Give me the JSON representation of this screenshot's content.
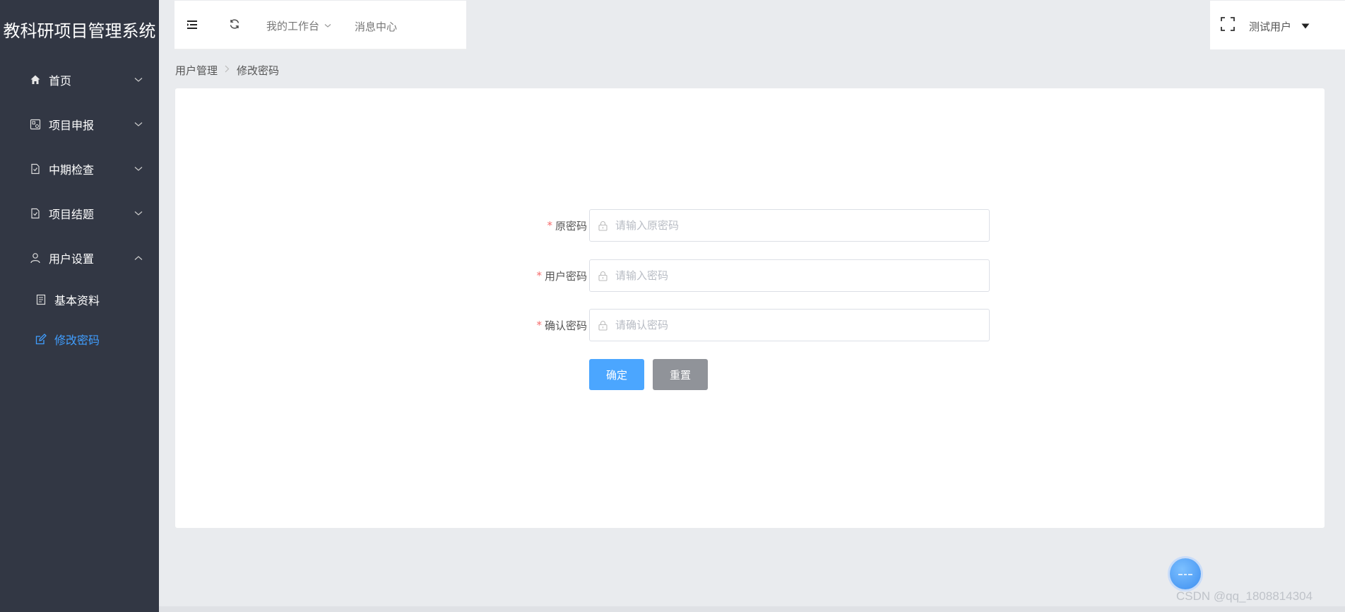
{
  "app": {
    "title": "教科研项目管理系统"
  },
  "sidebar": {
    "items": [
      {
        "label": "首页",
        "icon": "home-icon"
      },
      {
        "label": "项目申报",
        "icon": "project-apply-icon"
      },
      {
        "label": "中期检查",
        "icon": "doc-check-icon"
      },
      {
        "label": "项目结题",
        "icon": "doc-check-icon"
      },
      {
        "label": "用户设置",
        "icon": "user-icon"
      }
    ],
    "subitems": [
      {
        "label": "基本资料",
        "icon": "document-icon"
      },
      {
        "label": "修改密码",
        "icon": "edit-icon",
        "active": true
      }
    ]
  },
  "header": {
    "tabs": [
      {
        "label": "我的工作台"
      },
      {
        "label": "消息中心"
      }
    ],
    "user": "测试用户"
  },
  "breadcrumb": {
    "items": [
      "用户管理",
      "修改密码"
    ]
  },
  "form": {
    "fields": [
      {
        "label": "原密码",
        "placeholder": "请输入原密码",
        "required": "*"
      },
      {
        "label": "用户密码",
        "placeholder": "请输入密码",
        "required": "*"
      },
      {
        "label": "确认密码",
        "placeholder": "请确认密码",
        "required": "*"
      }
    ],
    "submit_label": "确定",
    "reset_label": "重置"
  },
  "watermark": "CSDN @qq_1808814304",
  "colors": {
    "sidebar_bg": "#323744",
    "accent": "#409eff",
    "primary_button": "#4ba6ff",
    "reset_button": "#909399",
    "required": "#f56c6c"
  }
}
